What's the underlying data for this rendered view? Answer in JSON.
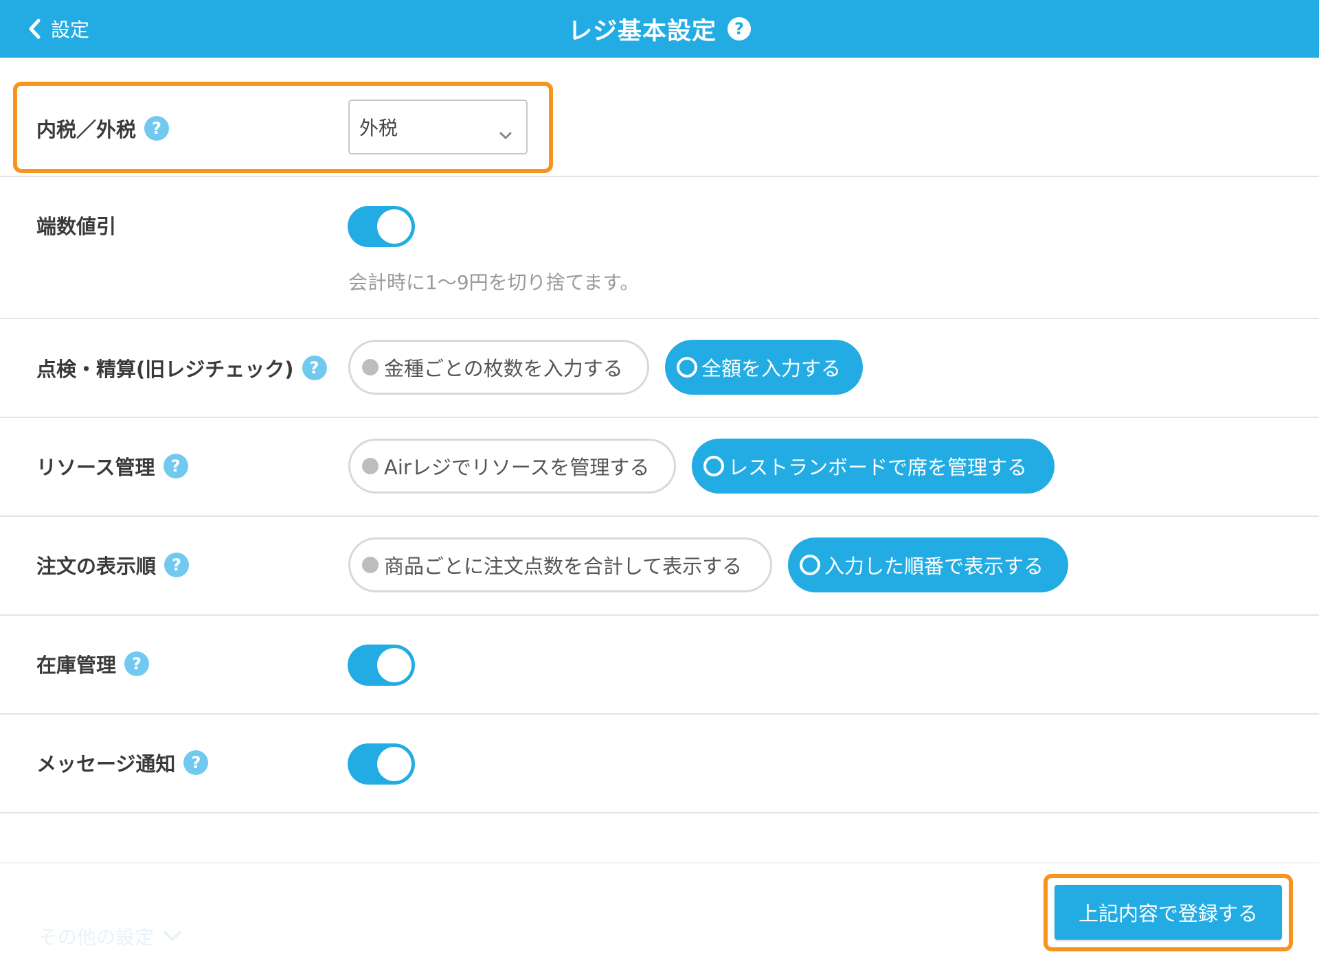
{
  "header": {
    "back_label": "設定",
    "title": "レジ基本設定",
    "help_symbol": "?"
  },
  "tax": {
    "label": "内税／外税",
    "help_symbol": "?",
    "selected": "外税"
  },
  "rounding": {
    "label": "端数値引",
    "enabled": true,
    "description": "会計時に1〜9円を切り捨てます。"
  },
  "inspection": {
    "label": "点検・精算(旧レジチェック)",
    "help_symbol": "?",
    "options": [
      "金種ごとの枚数を入力する",
      "全額を入力する"
    ],
    "selected_index": 1
  },
  "resource": {
    "label": "リソース管理",
    "help_symbol": "?",
    "options": [
      "Airレジでリソースを管理する",
      "レストランボードで席を管理する"
    ],
    "selected_index": 1
  },
  "order_display": {
    "label": "注文の表示順",
    "help_symbol": "?",
    "options": [
      "商品ごとに注文点数を合計して表示する",
      "入力した順番で表示する"
    ],
    "selected_index": 1
  },
  "inventory": {
    "label": "在庫管理",
    "help_symbol": "?",
    "enabled": true
  },
  "message": {
    "label": "メッセージ通知",
    "help_symbol": "?",
    "enabled": true
  },
  "footer": {
    "more_label": "その他の設定",
    "submit_label": "上記内容で登録する"
  },
  "colors": {
    "accent": "#23ace3",
    "highlight": "#f7941d",
    "help_badge": "#72c9ef"
  }
}
